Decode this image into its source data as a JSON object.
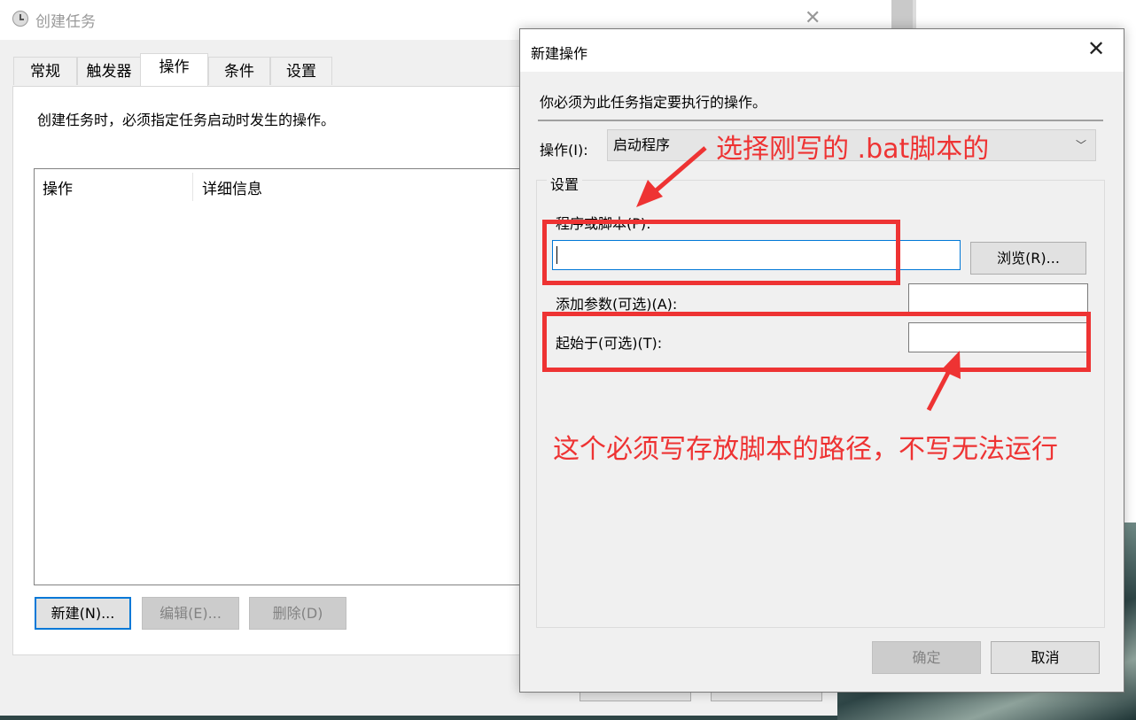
{
  "background_window": {
    "title": "创建任务",
    "tabs": [
      {
        "label": "常规"
      },
      {
        "label": "触发器"
      },
      {
        "label": "操作"
      },
      {
        "label": "条件"
      },
      {
        "label": "设置"
      }
    ],
    "description": "创建任务时，必须指定任务启动时发生的操作。",
    "columns": [
      "操作",
      "详细信息"
    ],
    "buttons": {
      "new": "新建(N)...",
      "edit": "编辑(E)...",
      "delete": "删除(D)"
    }
  },
  "dialog": {
    "title": "新建操作",
    "description": "你必须为此任务指定要执行的操作。",
    "action_label": "操作(I):",
    "action_value": "启动程序",
    "settings_group": "设置",
    "program_label": "程序或脚本(P):",
    "program_value": "",
    "browse_button": "浏览(R)...",
    "args_label": "添加参数(可选)(A):",
    "args_value": "",
    "start_in_label": "起始于(可选)(T):",
    "start_in_value": "",
    "ok_button": "确定",
    "cancel_button": "取消"
  },
  "annotations": {
    "top_note": "选择刚写的 .bat脚本的",
    "bottom_note": "这个必须写存放脚本的路径，不写无法运行",
    "color": "#ee3333"
  }
}
